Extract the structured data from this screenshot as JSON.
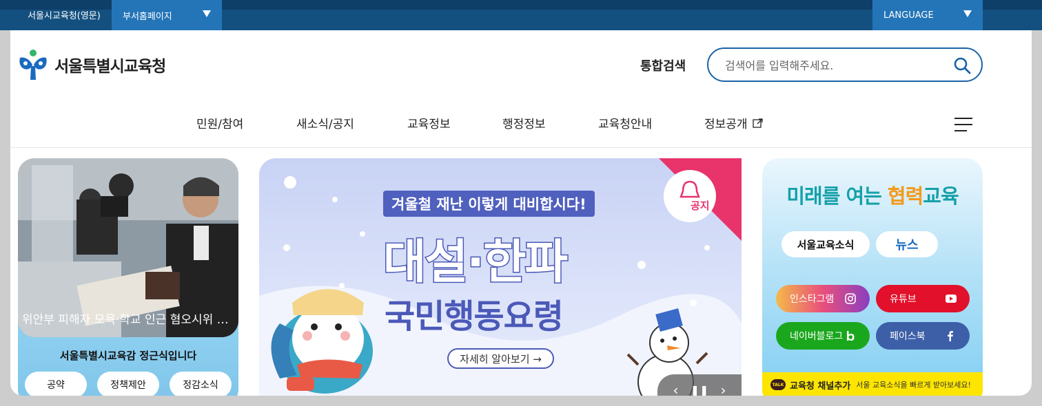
{
  "topbar": {
    "english_site": "서울시교육청(영문)",
    "dept_select": "부서홈페이지",
    "language_select": "LANGUAGE"
  },
  "header": {
    "logo_text": "서울특별시교육청",
    "search_label": "통합검색",
    "search_placeholder": "검색어를 입력해주세요."
  },
  "nav": {
    "items": [
      {
        "label": "민원/참여"
      },
      {
        "label": "새소식/공지"
      },
      {
        "label": "교육정보"
      },
      {
        "label": "행정정보"
      },
      {
        "label": "교육청안내"
      },
      {
        "label": "정보공개"
      }
    ]
  },
  "left_card": {
    "photo_caption": "위안부 피해자 모욕·학교 인근 혐오시위 반대",
    "title": "서울특별시교육감 정근식입니다",
    "buttons": [
      "공약",
      "정책제안",
      "정감소식"
    ]
  },
  "banner": {
    "top_text": "겨울철 재난 이렇게 대비합시다!",
    "main_line1": "대설·한파",
    "main_line2": "국민행동요령",
    "link_text": "자세히 알아보기 →",
    "badge_text": "공지"
  },
  "right_card": {
    "slogan_part1": "미래를 여는 ",
    "slogan_part2": "협력",
    "slogan_part3": "교육",
    "news_btn": "서울교육소식",
    "news_btn2": "뉴스",
    "sns": {
      "instagram": "인스타그램",
      "youtube": "유튜브",
      "blog": "네이버블로그",
      "facebook": "페이스북"
    },
    "kakao_badge": "TALK",
    "kakao_title": "교육청 채널추가",
    "kakao_desc": "서울 교육소식을 빠르게 받아보세요!"
  },
  "colors": {
    "topbar": "#14507f",
    "accent": "#2475b8",
    "nav_text": "#222222",
    "banner_purple": "#4b59b8"
  }
}
